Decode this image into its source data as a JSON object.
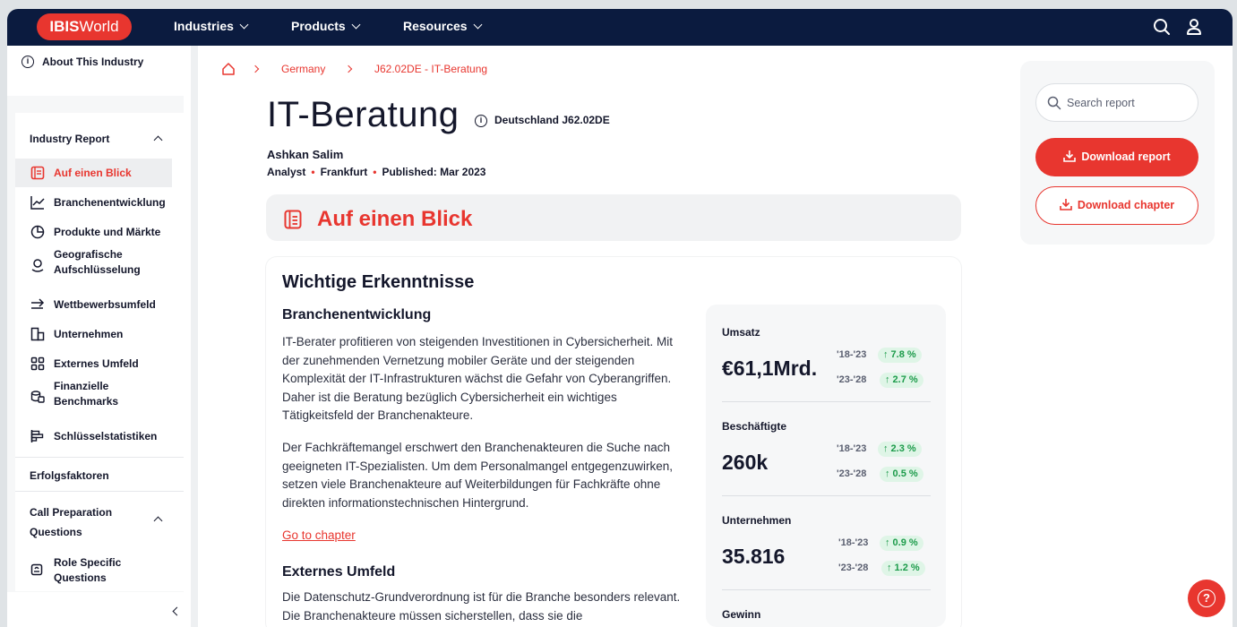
{
  "topbar": {
    "logo_bold": "IBIS",
    "logo_rest": "World",
    "nav": [
      "Industries",
      "Products",
      "Resources"
    ],
    "icons": [
      "search-icon",
      "user-icon"
    ]
  },
  "sidebar": {
    "about": "About This Industry",
    "industry_report": "Industry Report",
    "items": [
      {
        "label": "Auf einen Blick",
        "icon": "report-icon"
      },
      {
        "label": "Branchenentwicklung",
        "icon": "trend-chart-icon"
      },
      {
        "label": "Produkte und Märkte",
        "icon": "pie-chart-icon"
      },
      {
        "label": "Geografische Aufschlüsselung",
        "icon": "map-pin-icon"
      },
      {
        "label": "Wettbewerbsumfeld",
        "icon": "arrows-icon"
      },
      {
        "label": "Unternehmen",
        "icon": "building-icon"
      },
      {
        "label": "Externes Umfeld",
        "icon": "grid-icon"
      },
      {
        "label": "Finanzielle Benchmarks",
        "icon": "coins-icon"
      },
      {
        "label": "Schlüsselstatistiken",
        "icon": "bar-chart-icon"
      }
    ],
    "success_factors": "Erfolgsfaktoren",
    "call_prep": "Call Preparation Questions",
    "role_specific": "Role Specific Questions"
  },
  "breadcrumb": [
    "Germany",
    "J62.02DE - IT-Beratung"
  ],
  "header": {
    "title": "IT-Beratung",
    "code": "Deutschland J62.02DE",
    "author": "Ashkan Salim",
    "role": "Analyst",
    "location": "Frankfurt",
    "published": "Published: Mar 2023"
  },
  "section_title": "Auf einen Blick",
  "insights": {
    "title": "Wichtige Erkenntnisse",
    "block1_title": "Branchenentwicklung",
    "block1_p1": "IT-Berater profitieren von steigenden Investitionen in Cybersicherheit. Mit der zunehmenden Vernetzung mobiler Geräte und der steigenden Komplexität der IT-Infrastrukturen wächst die Gefahr von Cyberangriffen. Daher ist die Beratung bezüglich Cybersicherheit ein wichtiges Tätigkeitsfeld der Branchenakteure.",
    "block1_p2": "Der Fachkräftemangel erschwert den Branchenakteuren die Suche nach geeigneten IT-Spezialisten. Um dem Personalmangel entgegenzuwirken, setzen viele Branchenakteure auf Weiterbildungen für Fachkräfte ohne direkten informationstechnischen Hintergrund.",
    "link": "Go to chapter",
    "block2_title": "Externes Umfeld",
    "block2_p1": "Die Datenschutz-Grundverordnung ist für die Branche besonders relevant. Die Branchenakteure müssen sicherstellen, dass sie die"
  },
  "kpis": [
    {
      "label": "Umsatz",
      "value": "€61,1Mrd.",
      "p1": "'18-'23",
      "c1": "↑ 7.8 %",
      "p2": "'23-'28",
      "c2": "↑ 2.7 %"
    },
    {
      "label": "Beschäftigte",
      "value": "260k",
      "p1": "'18-'23",
      "c1": "↑ 2.3 %",
      "p2": "'23-'28",
      "c2": "↑ 0.5 %"
    },
    {
      "label": "Unternehmen",
      "value": "35.816",
      "p1": "'18-'23",
      "c1": "↑ 0.9 %",
      "p2": "'23-'28",
      "c2": "↑ 1.2 %"
    },
    {
      "label": "Gewinn"
    }
  ],
  "right": {
    "search_placeholder": "Search report",
    "download_report": "Download report",
    "download_chapter": "Download chapter"
  },
  "colors": {
    "brand": "#e8362f",
    "navy": "#0b1b3f",
    "positive": "#1c9b4a"
  }
}
